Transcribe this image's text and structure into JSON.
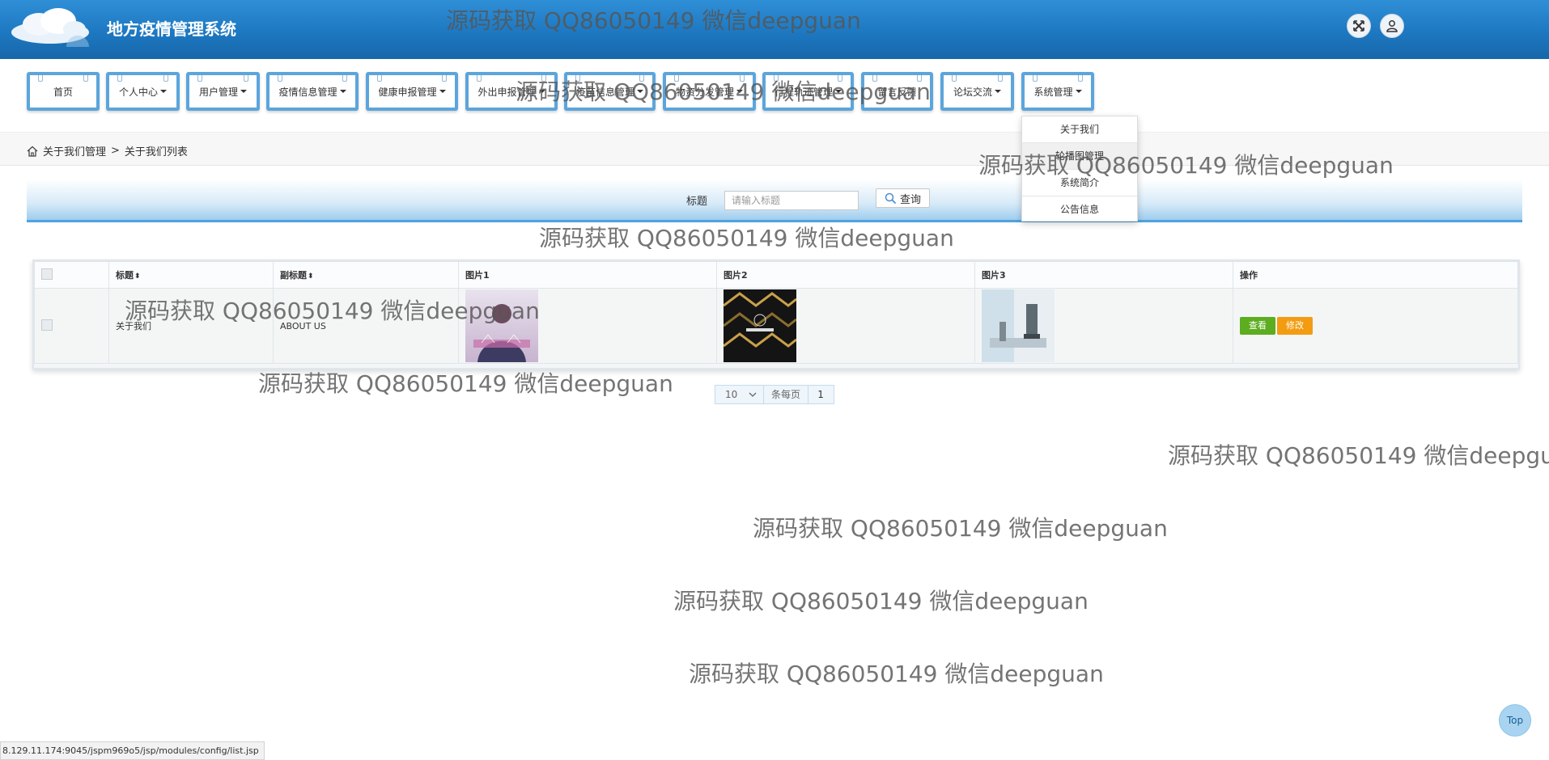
{
  "header": {
    "title": "地方疫情管理系统"
  },
  "nav": [
    {
      "label": "首页",
      "caret": false
    },
    {
      "label": "个人中心",
      "caret": true
    },
    {
      "label": "用户管理",
      "caret": true
    },
    {
      "label": "疫情信息管理",
      "caret": true
    },
    {
      "label": "健康申报管理",
      "caret": true
    },
    {
      "label": "外出申报管理",
      "caret": true
    },
    {
      "label": "疫苗信息管理",
      "caret": true
    },
    {
      "label": "物资分发管理",
      "caret": true
    },
    {
      "label": "行程轨迹管理",
      "caret": true
    },
    {
      "label": "留言反馈",
      "caret": false
    },
    {
      "label": "论坛交流",
      "caret": true
    },
    {
      "label": "系统管理",
      "caret": true
    }
  ],
  "dropdown": [
    "关于我们",
    "轮播图管理",
    "系统简介",
    "公告信息"
  ],
  "breadcrumb": {
    "parent": "关于我们管理",
    "separator": ">",
    "current": "关于我们列表"
  },
  "search": {
    "label": "标题",
    "placeholder": "请输入标题",
    "button": "查询"
  },
  "table": {
    "columns": [
      "标题",
      "副标题",
      "图片1",
      "图片2",
      "图片3",
      "操作"
    ],
    "rows": [
      {
        "title": "关于我们",
        "subtitle": "ABOUT US",
        "view": "查看",
        "edit": "修改"
      }
    ]
  },
  "pagination": {
    "page_size": "10",
    "per_page_label": "条每页",
    "page": "1"
  },
  "status_url": "8.129.11.174:9045/jspm969o5/jsp/modules/config/list.jsp",
  "top_button": "Top",
  "watermark": "源码获取 QQ86050149 微信deepguan",
  "colors": {
    "header": "#1d78c1",
    "nav_border": "#5ca5dc",
    "view_button": "#5cad1f",
    "edit_button": "#f39c12"
  },
  "icons": [
    "cloud-logo-icon",
    "fullscreen-icon",
    "user-icon",
    "home-icon",
    "search-icon",
    "select-chevron-icon"
  ]
}
